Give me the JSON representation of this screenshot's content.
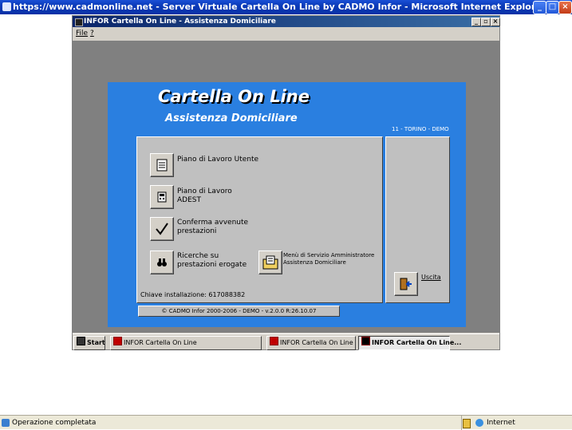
{
  "browser": {
    "title": "https://www.cadmonline.net - Server Virtuale Cartella On Line by CADMO Infor - Microsoft Internet Explorer",
    "status_text": "Operazione completata",
    "zone": "Internet"
  },
  "app": {
    "title": "INFOR Cartella On Line - Assistenza Domiciliare",
    "menu": {
      "file": "File",
      "help": "?"
    },
    "heading": "Cartella On Line",
    "subheading": "Assistenza Domiciliare",
    "location": "11 - TORINO - DEMO",
    "items": [
      {
        "line1": "Piano di Lavoro Utente",
        "line2": ""
      },
      {
        "line1": "Piano di Lavoro",
        "line2": "ADEST"
      },
      {
        "line1": "Conferma avvenute",
        "line2": "prestazioni"
      },
      {
        "line1": "Ricerche su",
        "line2": "prestazioni erogate"
      }
    ],
    "admin_menu": {
      "line1": "Menù di Servizio Amministratore",
      "line2": "Assistenza Domiciliare"
    },
    "exit_label": "Uscita",
    "install_key": "Chiave installazione: 617088382",
    "version": "© CADMO Infor 2000-2006 - DEMO - v.2.0.0 R:26.10.07"
  },
  "taskbar": {
    "start": "Start",
    "tasks": [
      "INFOR Cartella On Line",
      "INFOR Cartella On Line",
      "INFOR Cartella On Line..."
    ]
  },
  "colors": {
    "panel_blue": "#2a7fe0",
    "window_gray": "#808080",
    "titlebar": "#0a246a"
  }
}
